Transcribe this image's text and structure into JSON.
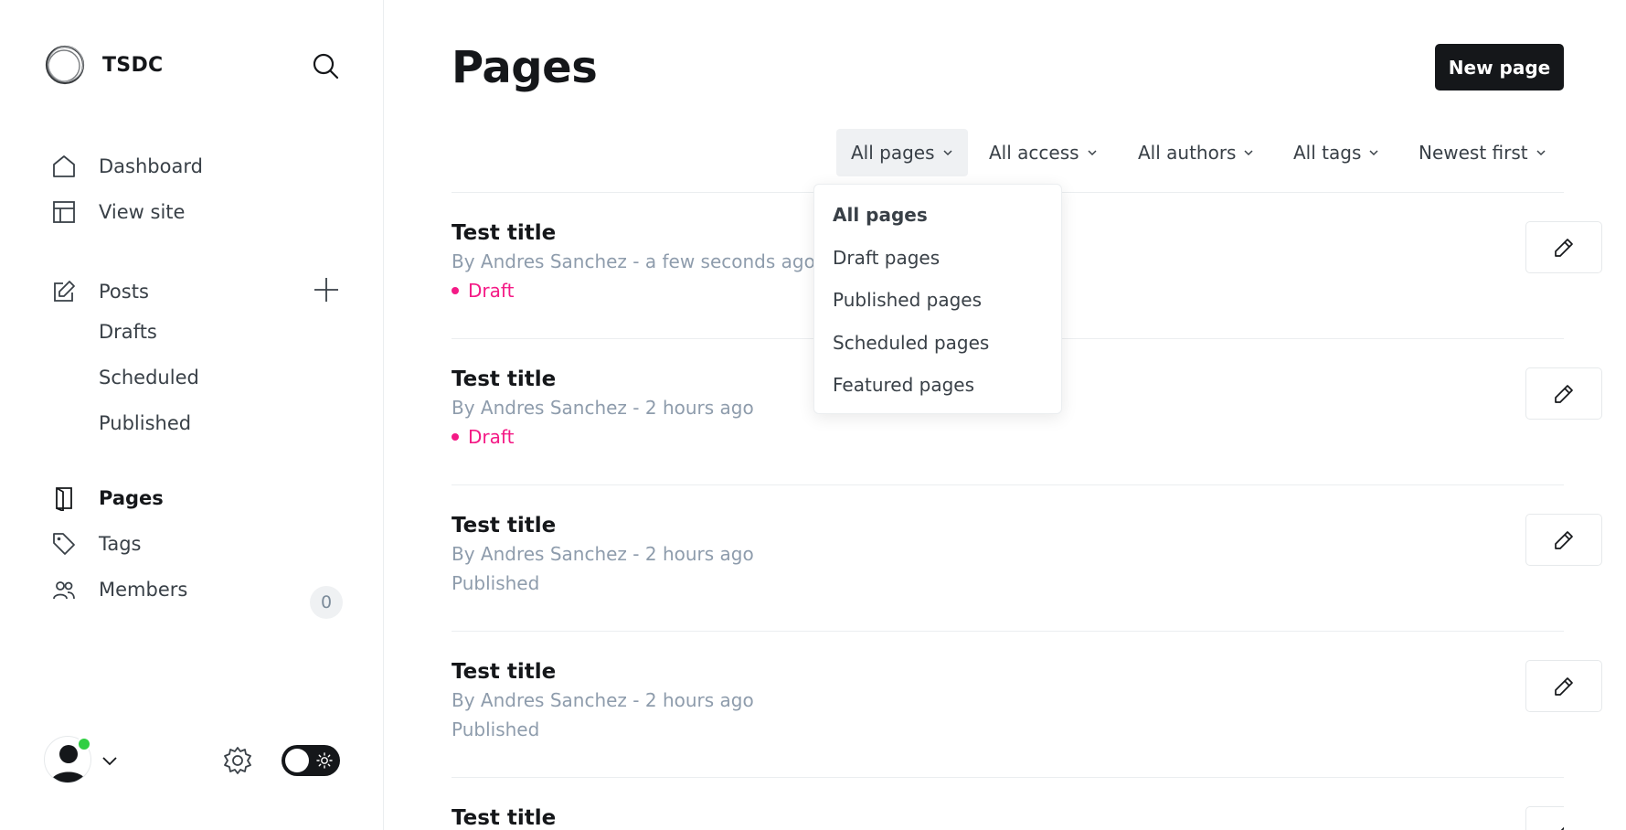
{
  "sidebar": {
    "brand": "TSDC",
    "nav_top": [
      {
        "label": "Dashboard",
        "icon": "home-icon"
      },
      {
        "label": "View site",
        "icon": "layout-icon"
      }
    ],
    "posts": {
      "label": "Posts",
      "sub": [
        "Drafts",
        "Scheduled",
        "Published"
      ]
    },
    "nav_bottom": [
      {
        "label": "Pages",
        "icon": "page-icon",
        "active": true
      },
      {
        "label": "Tags",
        "icon": "tag-icon"
      },
      {
        "label": "Members",
        "icon": "members-icon"
      }
    ],
    "members_count": "0"
  },
  "main": {
    "title": "Pages",
    "new_button": "New page",
    "filters": [
      "All pages",
      "All access",
      "All authors",
      "All tags",
      "Newest first"
    ],
    "dropdown": {
      "items": [
        "All pages",
        "Draft pages",
        "Published pages",
        "Scheduled pages",
        "Featured pages"
      ],
      "selected": "All pages"
    },
    "rows": [
      {
        "title": "Test title",
        "meta": "By Andres Sanchez - a few seconds ago",
        "status": "Draft"
      },
      {
        "title": "Test title",
        "meta": "By Andres Sanchez - 2 hours ago",
        "status": "Draft"
      },
      {
        "title": "Test title",
        "meta": "By Andres Sanchez - 2 hours ago",
        "status": "Published"
      },
      {
        "title": "Test title",
        "meta": "By Andres Sanchez - 2 hours ago",
        "status": "Published"
      },
      {
        "title": "Test title",
        "meta": "",
        "status": ""
      }
    ]
  },
  "colors": {
    "accent": "#15171a",
    "draft": "#f41a86",
    "muted": "#8e9cac",
    "online": "#30cf43"
  }
}
